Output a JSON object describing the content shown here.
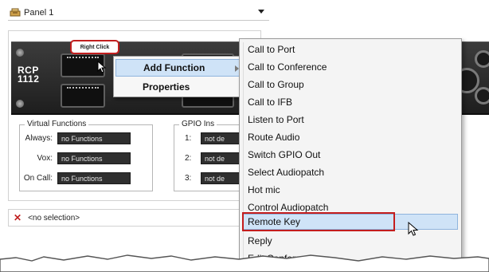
{
  "panel_selector": {
    "label": "Panel 1",
    "icon": "panel-icon"
  },
  "hardware": {
    "model_line1": "RCP",
    "model_line2": "1112"
  },
  "callout": {
    "label": "Right Click"
  },
  "context_menu_primary": {
    "items": [
      {
        "label": "Add Function",
        "has_submenu": true,
        "highlighted": true
      },
      {
        "label": "Properties"
      }
    ]
  },
  "virtual_functions": {
    "legend": "Virtual Functions",
    "rows": [
      {
        "label": "Always:",
        "value": "no Functions"
      },
      {
        "label": "Vox:",
        "value": "no Functions"
      },
      {
        "label": "On Call:",
        "value": "no Functions"
      }
    ]
  },
  "gpio_ins": {
    "legend": "GPIO Ins",
    "rows": [
      {
        "label": "1:",
        "value": "not de"
      },
      {
        "label": "2:",
        "value": "not de"
      },
      {
        "label": "3:",
        "value": "not de"
      }
    ]
  },
  "selection_bar": {
    "text": "<no selection>",
    "icon": "clear-x-icon"
  },
  "context_menu_functions": {
    "items": [
      {
        "label": "Call to Port"
      },
      {
        "label": "Call to Conference"
      },
      {
        "label": "Call to Group"
      },
      {
        "label": "Call to IFB"
      },
      {
        "label": "Listen to Port"
      },
      {
        "label": "Route Audio"
      },
      {
        "label": "Switch GPIO Out"
      },
      {
        "label": "Select Audiopatch"
      },
      {
        "label": "Hot mic"
      },
      {
        "label": "Control Audiopatch"
      },
      {
        "label": "Remote Key",
        "selected": true
      },
      {
        "label": "Reply"
      },
      {
        "label": "Edit Conference"
      }
    ]
  },
  "colors": {
    "highlight": "#cfe3f7",
    "callout_border": "#c21f1f",
    "panel_dark": "#1e1e1e"
  }
}
